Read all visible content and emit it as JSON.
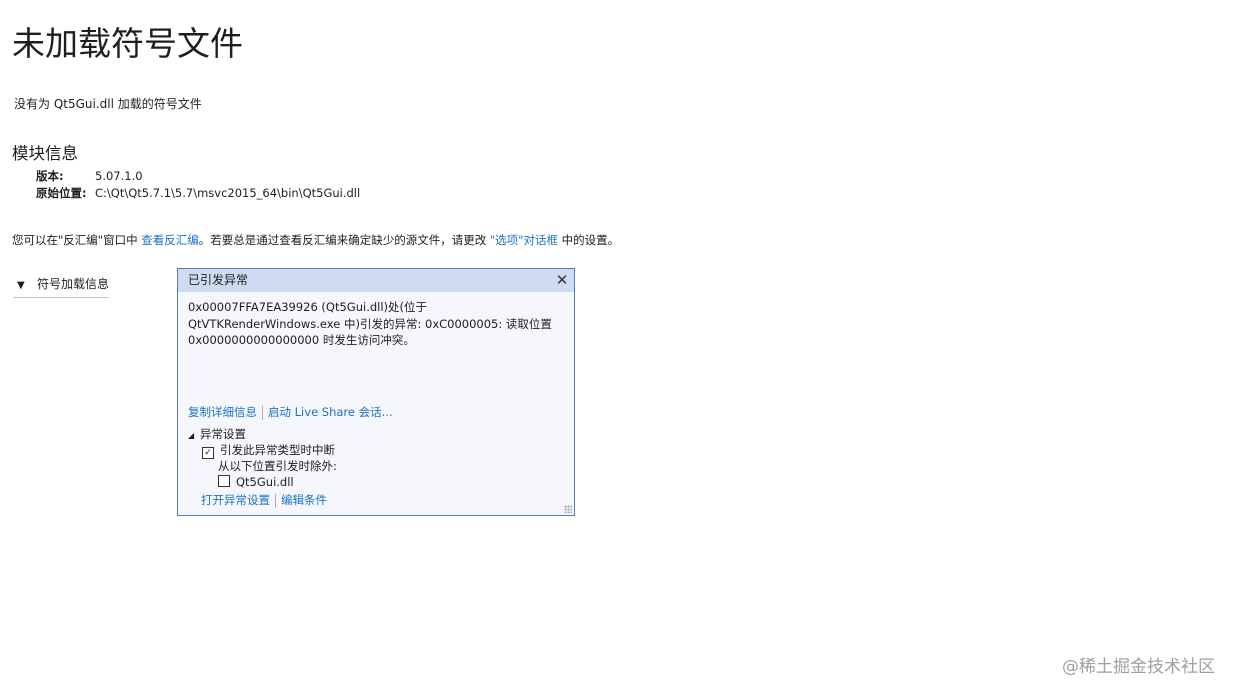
{
  "page": {
    "title": "未加载符号文件",
    "subtitle": "没有为 Qt5Gui.dll 加载的符号文件"
  },
  "module_info": {
    "heading": "模块信息",
    "version_label": "版本:",
    "version_value": "5.07.1.0",
    "location_label": "原始位置:",
    "location_value": "C:\\Qt\\Qt5.7.1\\5.7\\msvc2015_64\\bin\\Qt5Gui.dll"
  },
  "hint": {
    "text_before": "您可以在\"反汇编\"窗口中 ",
    "link_disassembly": "查看反汇编",
    "text_middle": "。若要总是通过查看反汇编来确定缺少的源文件，请更改 ",
    "link_options": "\"选项\"对话框",
    "text_after": " 中的设置。"
  },
  "symbol_load": {
    "label": "符号加载信息",
    "chevron_icon": "chevron-down-icon"
  },
  "exception_popup": {
    "title": "已引发异常",
    "close_icon": "close-icon",
    "message_line1": "0x00007FFA7EA39926 (Qt5Gui.dll)处(位于",
    "message_line2": "QtVTKRenderWindows.exe 中)引发的异常: 0xC0000005: 读取位置",
    "message_line3": "0x0000000000000000 时发生访问冲突。",
    "link_copy_details": "复制详细信息",
    "link_live_share": "启动 Live Share 会话...",
    "settings_heading": "异常设置",
    "break_when_thrown_label": "引发此异常类型时中断",
    "break_when_thrown_checked": true,
    "except_when_label": "从以下位置引发时除外:",
    "except_module_label": "Qt5Gui.dll",
    "except_module_checked": false,
    "link_open_settings": "打开异常设置",
    "link_edit_conditions": "编辑条件"
  },
  "watermark": "@稀土掘金技术社区"
}
